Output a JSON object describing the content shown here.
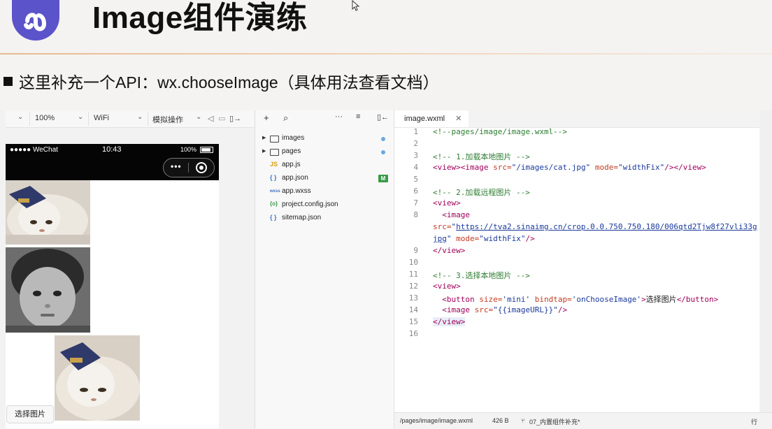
{
  "slide": {
    "title": "Image组件演练",
    "bullet": "这里补充一个API：wx.chooseImage（具体用法查看文档）"
  },
  "simulator": {
    "toolbar": {
      "device_chevron": "⌄",
      "zoom": "100%",
      "network": "WiFi",
      "action": "模拟操作"
    },
    "status_bar": {
      "carrier": "●●●●● WeChat",
      "time": "10:43",
      "battery": "100%"
    },
    "capsule_menu": "•••",
    "choose_button_label": "选择图片"
  },
  "explorer": {
    "toolbar": {
      "add": "+",
      "search": "⌕",
      "more": "···"
    },
    "items": [
      {
        "label": "images",
        "type": "folder",
        "badge": "dot"
      },
      {
        "label": "pages",
        "type": "folder",
        "badge": "dot"
      },
      {
        "label": "app.js",
        "type": "js",
        "icon": "JS"
      },
      {
        "label": "app.json",
        "type": "json",
        "icon": "{ }",
        "badge": "M"
      },
      {
        "label": "app.wxss",
        "type": "wxss",
        "icon": "wxss"
      },
      {
        "label": "project.config.json",
        "type": "config",
        "icon": "{o}"
      },
      {
        "label": "sitemap.json",
        "type": "json",
        "icon": "{ }"
      }
    ]
  },
  "editor": {
    "tab_label": "image.wxml",
    "line_numbers": [
      "1",
      "2",
      "3",
      "4",
      "5",
      "6",
      "7",
      "8",
      "",
      "",
      "9",
      "10",
      "11",
      "12",
      "13",
      "14",
      "15",
      "16"
    ],
    "lines": {
      "l1": "<!--pages/image/image.wxml-->",
      "l3": "<!-- 1.加载本地图片 -->",
      "l4_a": "<view>",
      "l4_b": "<image",
      "l4_c": " src=",
      "l4_d": "\"/images/cat.jpg\"",
      "l4_e": " mode=",
      "l4_f": "\"widthFix\"",
      "l4_g": "/>",
      "l4_h": "</view>",
      "l6": "<!-- 2.加载远程图片 -->",
      "l7": "<view>",
      "l8": "  <image",
      "l8w_a": "src=",
      "l8w_b": "\"",
      "l8w_url": "https://tva2.sinaimg.cn/crop.0.0.750.750.180/006qtd2Tjw8f27vli33g",
      "l8w2_url": "jpg",
      "l8w2_b": "\"",
      "l8w2_c": " mode=",
      "l8w2_d": "\"widthFix\"",
      "l8w2_e": "/>",
      "l9": "</view>",
      "l11": "<!-- 3.选择本地图片 -->",
      "l12": "<view>",
      "l13_a": "  <button",
      "l13_b": " size=",
      "l13_c": "'mini'",
      "l13_d": " bindtap=",
      "l13_e": "'onChooseImage'",
      "l13_f": ">",
      "l13_g": "选择图片",
      "l13_h": "</button>",
      "l14_a": "  <image",
      "l14_b": " src=",
      "l14_c": "\"{{imageURL}}\"",
      "l14_d": "/>",
      "l15": "</view>"
    }
  },
  "statusbar": {
    "path": "/pages/image/image.wxml",
    "size": "426 B",
    "branch": "07_内置组件补充*",
    "right": "行"
  }
}
